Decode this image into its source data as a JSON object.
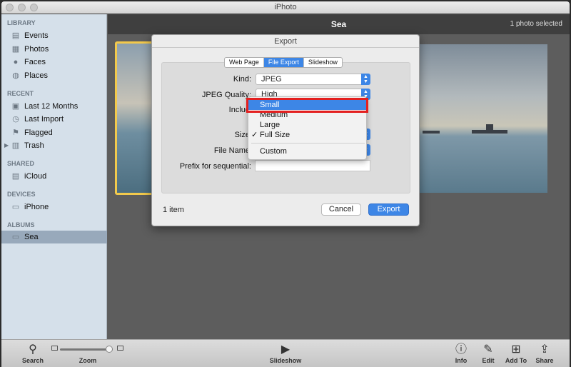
{
  "window": {
    "title": "iPhoto"
  },
  "sidebar": {
    "sections": [
      {
        "title": "LIBRARY",
        "items": [
          {
            "label": "Events",
            "icon": "events-icon"
          },
          {
            "label": "Photos",
            "icon": "photos-icon"
          },
          {
            "label": "Faces",
            "icon": "faces-icon"
          },
          {
            "label": "Places",
            "icon": "places-icon"
          }
        ]
      },
      {
        "title": "RECENT",
        "items": [
          {
            "label": "Last 12 Months",
            "icon": "calendar-icon"
          },
          {
            "label": "Last Import",
            "icon": "import-icon"
          },
          {
            "label": "Flagged",
            "icon": "flag-icon"
          },
          {
            "label": "Trash",
            "icon": "trash-icon"
          }
        ]
      },
      {
        "title": "SHARED",
        "items": [
          {
            "label": "iCloud",
            "icon": "cloud-icon"
          }
        ]
      },
      {
        "title": "DEVICES",
        "items": [
          {
            "label": "iPhone",
            "icon": "iphone-icon"
          }
        ]
      },
      {
        "title": "ALBUMS",
        "items": [
          {
            "label": "Sea",
            "icon": "album-icon",
            "selected": true
          }
        ]
      }
    ]
  },
  "main": {
    "title": "Sea",
    "selection_status": "1 photo selected"
  },
  "dialog": {
    "title": "Export",
    "tabs": [
      {
        "label": "Web Page",
        "active": false
      },
      {
        "label": "File Export",
        "active": true
      },
      {
        "label": "Slideshow",
        "active": false
      }
    ],
    "fields": {
      "kind_label": "Kind:",
      "kind_value": "JPEG",
      "quality_label": "JPEG Quality:",
      "quality_value": "High",
      "include_label": "Includ",
      "size_label": "Size",
      "filename_label": "File Name",
      "prefix_label": "Prefix for sequential:",
      "prefix_value": ""
    },
    "size_menu": {
      "options": [
        "Small",
        "Medium",
        "Large",
        "Full Size",
        "Custom"
      ],
      "highlighted": "Small",
      "checked": "Full Size"
    },
    "item_count": "1 item",
    "cancel_label": "Cancel",
    "export_label": "Export"
  },
  "toolbar": {
    "search": "Search",
    "zoom": "Zoom",
    "slideshow": "Slideshow",
    "info": "Info",
    "edit": "Edit",
    "add_to": "Add To",
    "share": "Share"
  },
  "colors": {
    "accent": "#3d86e6",
    "highlight_box": "#e32020",
    "selection_border": "#f2c94c"
  }
}
